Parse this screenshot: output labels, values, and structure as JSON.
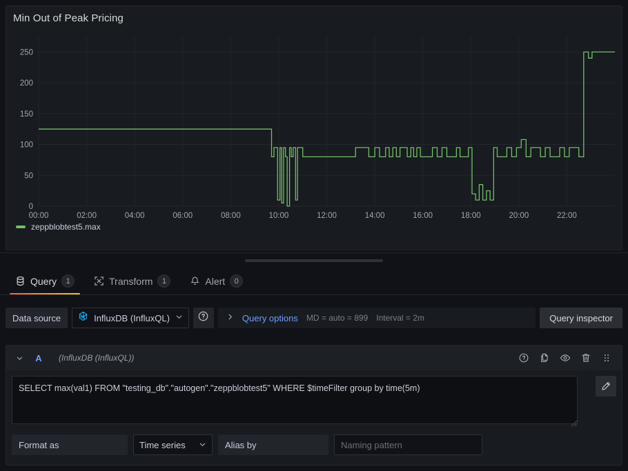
{
  "panel": {
    "title": "Min Out of Peak Pricing",
    "legend": [
      {
        "label": "zeppblobtest5.max",
        "color": "#73bf69"
      }
    ]
  },
  "chart_data": {
    "type": "line",
    "title": "Min Out of Peak Pricing",
    "xlabel": "",
    "ylabel": "",
    "grid": true,
    "legend_position": "bottom-left",
    "line_color": "#73bf69",
    "ylim": [
      0,
      275
    ],
    "yticks": [
      0,
      50,
      100,
      150,
      200,
      250
    ],
    "xtick_labels": [
      "00:00",
      "02:00",
      "04:00",
      "06:00",
      "08:00",
      "10:00",
      "12:00",
      "14:00",
      "16:00",
      "18:00",
      "20:00",
      "22:00"
    ],
    "xlim_hours": [
      0,
      24
    ],
    "series": [
      {
        "name": "zeppblobtest5.max",
        "x_hours": [
          0.0,
          9.6,
          9.7,
          9.8,
          9.95,
          10.05,
          10.12,
          10.2,
          10.28,
          10.35,
          10.45,
          10.52,
          10.6,
          10.7,
          10.78,
          10.9,
          11.0,
          11.1,
          11.2,
          11.35,
          11.5,
          13.0,
          13.2,
          13.55,
          13.75,
          14.0,
          14.2,
          14.45,
          14.6,
          14.75,
          14.9,
          15.05,
          15.2,
          15.35,
          15.5,
          15.62,
          15.75,
          15.9,
          16.05,
          16.2,
          16.4,
          16.6,
          16.8,
          17.0,
          17.2,
          17.4,
          17.55,
          17.7,
          17.9,
          18.05,
          18.2,
          18.35,
          18.5,
          18.65,
          18.8,
          18.95,
          19.1,
          19.3,
          19.5,
          19.7,
          19.9,
          20.1,
          20.3,
          20.5,
          20.7,
          20.9,
          21.1,
          21.3,
          21.5,
          21.7,
          21.9,
          22.1,
          22.3,
          22.5,
          22.7,
          22.9,
          23.05,
          23.2,
          23.4,
          24.0
        ],
        "y_values": [
          125,
          125,
          80,
          95,
          10,
          95,
          5,
          95,
          80,
          0,
          95,
          80,
          95,
          10,
          95,
          95,
          80,
          80,
          80,
          80,
          80,
          80,
          95,
          95,
          80,
          95,
          80,
          95,
          80,
          95,
          80,
          95,
          95,
          80,
          95,
          80,
          95,
          80,
          80,
          80,
          95,
          80,
          95,
          80,
          80,
          95,
          80,
          80,
          95,
          20,
          10,
          35,
          10,
          25,
          10,
          95,
          80,
          80,
          95,
          80,
          95,
          108,
          80,
          95,
          95,
          80,
          95,
          80,
          80,
          95,
          80,
          95,
          95,
          80,
          250,
          240,
          250,
          250,
          250,
          250
        ]
      }
    ]
  },
  "tabs": [
    {
      "label": "Query",
      "badge": "1",
      "icon": "database-icon",
      "active": true
    },
    {
      "label": "Transform",
      "badge": "1",
      "icon": "transform-icon",
      "active": false
    },
    {
      "label": "Alert",
      "badge": "0",
      "icon": "bell-icon",
      "active": false
    }
  ],
  "datasource_row": {
    "label": "Data source",
    "selected": "InfluxDB (InfluxQL)",
    "help_icon": "help-circle-icon",
    "query_options_label": "Query options",
    "max_data_points": "MD = auto = 899",
    "interval": "Interval = 2m",
    "query_inspector_label": "Query inspector"
  },
  "query": {
    "ref_id": "A",
    "datasource_name": "(InfluxDB (InfluxQL))",
    "sql": "SELECT max(val1) FROM \"testing_db\".\"autogen\".\"zeppblobtest5\" WHERE $timeFilter group by time(5m)",
    "actions": [
      "help-circle-icon",
      "duplicate-icon",
      "eye-icon",
      "trash-icon",
      "drag-handle-icon"
    ],
    "format_as_label": "Format as",
    "format_as_value": "Time series",
    "alias_by_label": "Alias by",
    "alias_by_placeholder": "Naming pattern"
  },
  "colors": {
    "accent_blue": "#6e9fff",
    "series_green": "#73bf69",
    "tab_underline_start": "#f55f3e",
    "tab_underline_end": "#f2cc0c",
    "panel_bg": "#181b1f",
    "page_bg": "#111217"
  }
}
